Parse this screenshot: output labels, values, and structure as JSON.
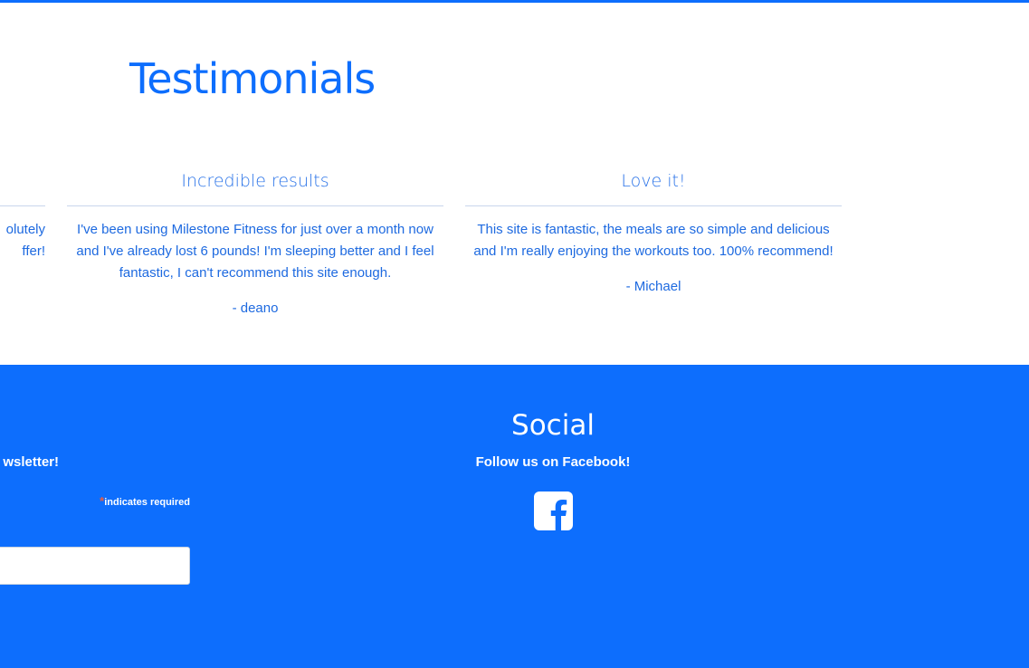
{
  "colors": {
    "brand_blue": "#0d6efd",
    "text_blue": "#1e6ae0",
    "required_star": "#e85c41"
  },
  "testimonials": {
    "title": "Testimonials",
    "partial_card": {
      "line1": "olutely",
      "line2": "ffer!"
    },
    "cards": [
      {
        "heading": "Incredible results",
        "text": "I've been using Milestone Fitness for just over a month now and I've already lost 6 pounds! I'm sleeping better and I feel fantastic, I can't recommend this site enough.",
        "author": "- deano"
      },
      {
        "heading": "Love it!",
        "text": "This site is fantastic, the meals are so simple and delicious and I'm really enjoying the workouts too. 100% recommend!",
        "author": "- Michael"
      }
    ]
  },
  "footer": {
    "newsletter": {
      "text": "wsletter!",
      "required_star": "*",
      "required_label": "indicates required",
      "email_value": ""
    },
    "social": {
      "title": "Social",
      "subtitle": "Follow us on Facebook!",
      "icon": "facebook-icon"
    }
  }
}
